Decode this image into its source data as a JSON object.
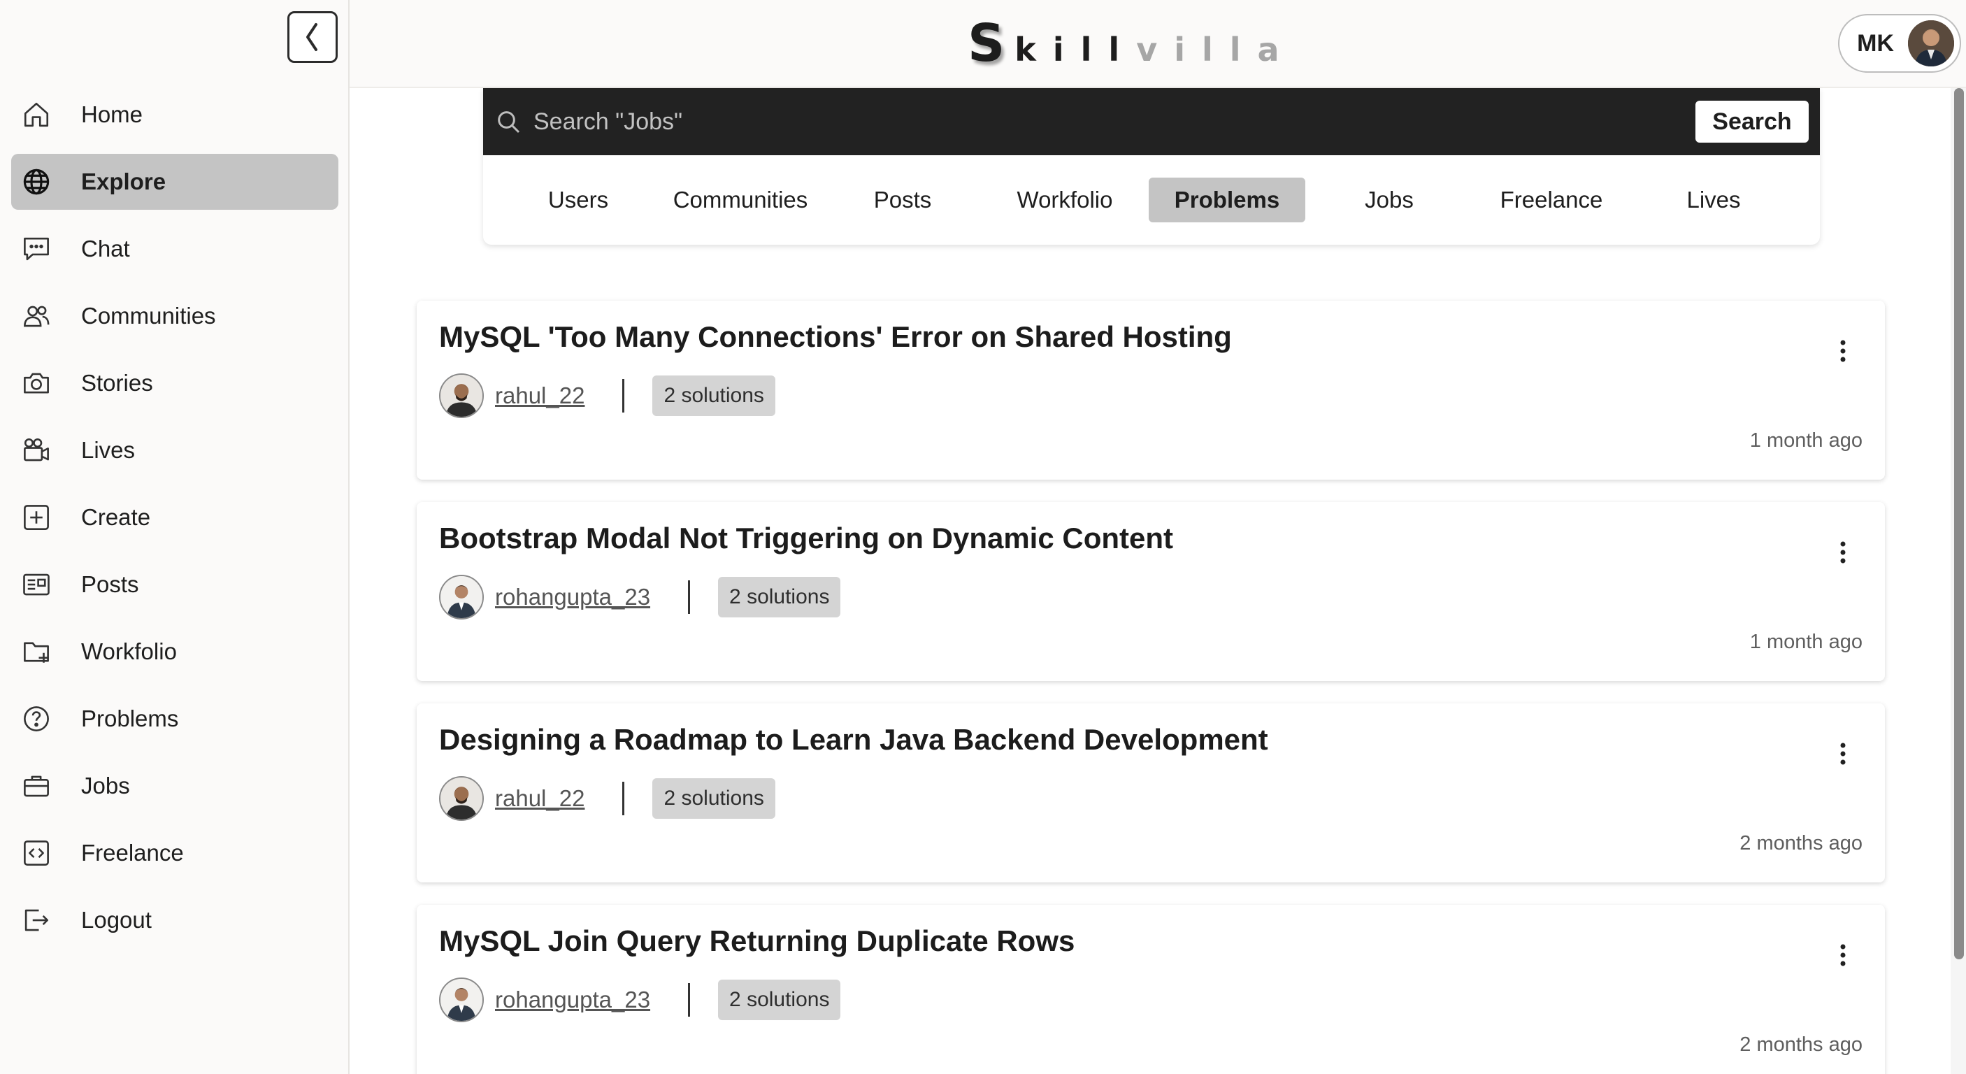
{
  "brand": {
    "first": "S",
    "dark": "kill",
    "light": "villa"
  },
  "user": {
    "initials": "MK"
  },
  "sidebar": {
    "items": [
      {
        "label": "Home",
        "icon": "home-icon",
        "active": false
      },
      {
        "label": "Explore",
        "icon": "globe-icon",
        "active": true
      },
      {
        "label": "Chat",
        "icon": "chat-icon",
        "active": false
      },
      {
        "label": "Communities",
        "icon": "users-icon",
        "active": false
      },
      {
        "label": "Stories",
        "icon": "camera-icon",
        "active": false
      },
      {
        "label": "Lives",
        "icon": "video-icon",
        "active": false
      },
      {
        "label": "Create",
        "icon": "plus-square-icon",
        "active": false
      },
      {
        "label": "Posts",
        "icon": "newspaper-icon",
        "active": false
      },
      {
        "label": "Workfolio",
        "icon": "folder-plus-icon",
        "active": false
      },
      {
        "label": "Problems",
        "icon": "question-circle-icon",
        "active": false
      },
      {
        "label": "Jobs",
        "icon": "briefcase-icon",
        "active": false
      },
      {
        "label": "Freelance",
        "icon": "code-square-icon",
        "active": false
      },
      {
        "label": "Logout",
        "icon": "logout-icon",
        "active": false
      }
    ]
  },
  "search": {
    "placeholder": "Search \"Jobs\"",
    "button_label": "Search"
  },
  "tabs": [
    {
      "label": "Users",
      "active": false
    },
    {
      "label": "Communities",
      "active": false
    },
    {
      "label": "Posts",
      "active": false
    },
    {
      "label": "Workfolio",
      "active": false
    },
    {
      "label": "Problems",
      "active": true
    },
    {
      "label": "Jobs",
      "active": false
    },
    {
      "label": "Freelance",
      "active": false
    },
    {
      "label": "Lives",
      "active": false
    }
  ],
  "problems": [
    {
      "title": "MySQL 'Too Many Connections' Error on Shared Hosting",
      "username": "rahul_22",
      "solutions": "2 solutions",
      "time": "1 month ago"
    },
    {
      "title": "Bootstrap Modal Not Triggering on Dynamic Content",
      "username": "rohangupta_23",
      "solutions": "2 solutions",
      "time": "1 month ago"
    },
    {
      "title": "Designing a Roadmap to Learn Java Backend Development",
      "username": "rahul_22",
      "solutions": "2 solutions",
      "time": "2 months ago"
    },
    {
      "title": "MySQL Join Query Returning Duplicate Rows",
      "username": "rohangupta_23",
      "solutions": "2 solutions",
      "time": "2 months ago"
    }
  ],
  "colors": {
    "search_bar_bg": "#222222",
    "active_bg": "#c4c4c4",
    "badge_bg": "#d4d4d4",
    "page_bg": "#fbfaf9"
  }
}
